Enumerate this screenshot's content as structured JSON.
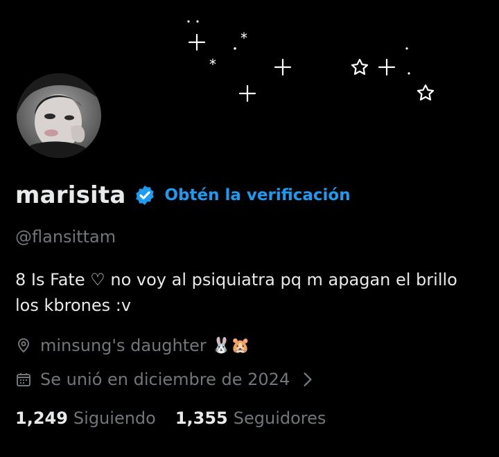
{
  "profile": {
    "display_name": "marisita",
    "verified_icon": "verified-badge-icon",
    "verify_link": "Obtén la verificación",
    "handle": "@flansittam",
    "bio_line1": "8 Is Fate ♡ no voy al psiquiatra pq m apagan el brillo",
    "bio_line2": "los kbrones :v",
    "location": "minsung's daughter",
    "location_emoji": "🐰🐹",
    "joined": "Se unió en diciembre de 2024",
    "following_count": "1,249",
    "following_label": "Siguiendo",
    "followers_count": "1,355",
    "followers_label": "Seguidores"
  },
  "icons": {
    "location": "location-pin-icon",
    "calendar": "calendar-icon",
    "chevron": "chevron-right-icon"
  },
  "colors": {
    "background": "#000000",
    "text_primary": "#e7e9ea",
    "text_secondary": "#71767b",
    "accent": "#1d9bf0"
  }
}
